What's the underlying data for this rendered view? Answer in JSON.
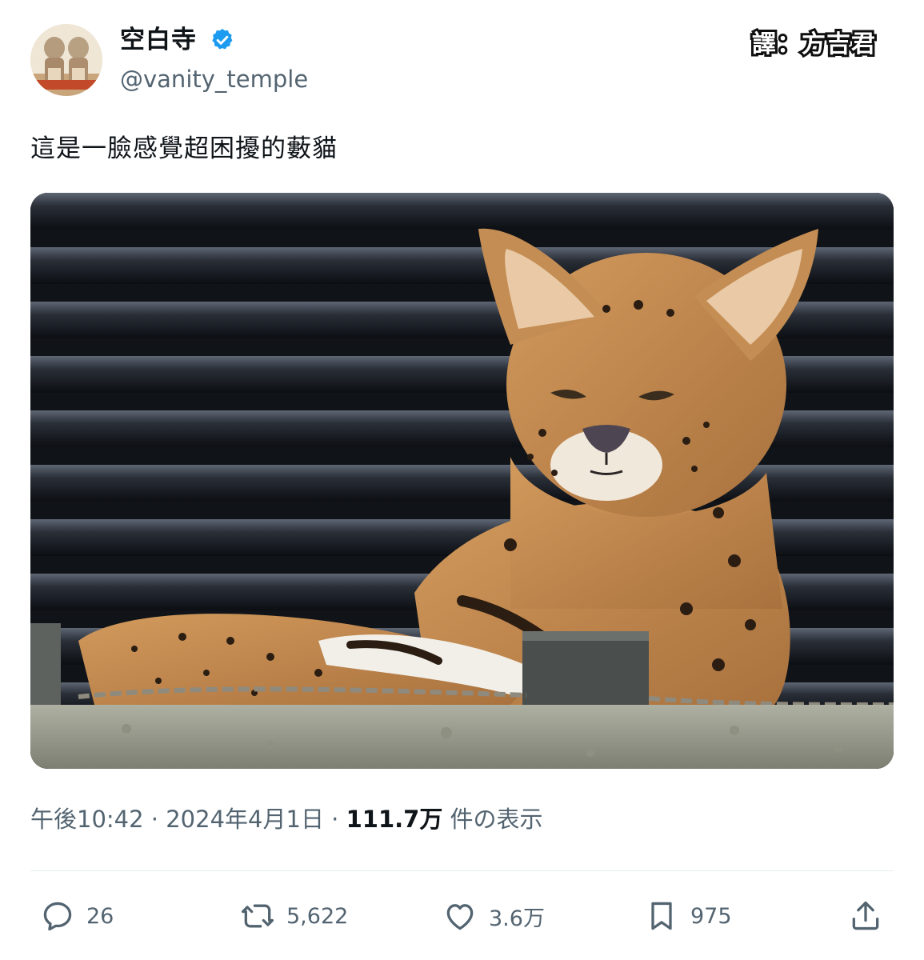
{
  "author": {
    "display_name": "空白寺",
    "handle": "@vanity_temple",
    "verified": true,
    "verified_color": "#1d9bf0"
  },
  "overlay": {
    "translator": "譯：方吉君"
  },
  "tweet": {
    "text": "這是一臉感覺超困擾的藪貓"
  },
  "meta": {
    "time": "午後10:42",
    "separator1": " · ",
    "date": "2024年4月1日",
    "separator2": " · ",
    "views_count": "111.7万",
    "views_label": " 件の表示"
  },
  "actions": {
    "replies": {
      "icon": "reply-icon",
      "count": "26"
    },
    "retweets": {
      "icon": "retweet-icon",
      "count": "5,622"
    },
    "likes": {
      "icon": "heart-icon",
      "count": "3.6万"
    },
    "bookmarks": {
      "icon": "bookmark-icon",
      "count": "975"
    },
    "share": {
      "icon": "share-icon"
    }
  },
  "colors": {
    "text_primary": "#0f1419",
    "text_secondary": "#536471",
    "divider": "#e6ecf0"
  }
}
